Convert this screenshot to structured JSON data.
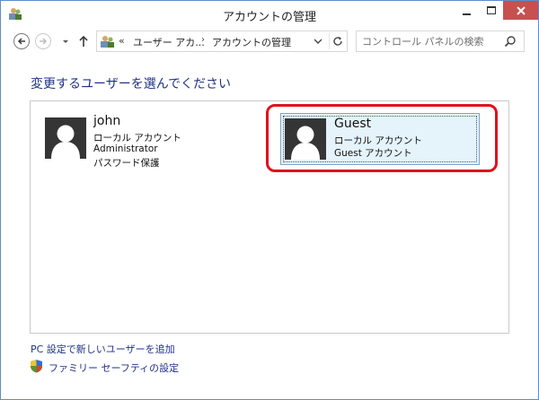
{
  "window": {
    "title": "アカウントの管理",
    "icon": "users-control-panel-icon",
    "close_color": "#c75050",
    "border_color": "#5e8cc9"
  },
  "toolbar": {
    "back_icon": "back-arrow-icon",
    "forward_icon": "forward-arrow-icon",
    "recent_icon": "chevron-down-icon",
    "up_icon": "up-arrow-icon",
    "breadcrumb": {
      "overflow": "«",
      "items": [
        "ユーザー アカ...",
        "アカウントの管理"
      ],
      "separator": "›"
    },
    "search": {
      "placeholder": "コントロール パネルの検索",
      "value": ""
    }
  },
  "main": {
    "heading": "変更するユーザーを選んでください",
    "heading_color": "#1e3287",
    "users": [
      {
        "name": "john",
        "lines": [
          "ローカル アカウント",
          "Administrator",
          "パスワード保護"
        ]
      },
      {
        "name": "Guest",
        "lines": [
          "ローカル アカウント",
          "Guest アカウント"
        ],
        "selected": true
      }
    ],
    "highlight_color": "#e0101e"
  },
  "links": {
    "add_user": "PC 設定で新しいユーザーを追加",
    "family_safety": "ファミリー セーフティの設定"
  }
}
